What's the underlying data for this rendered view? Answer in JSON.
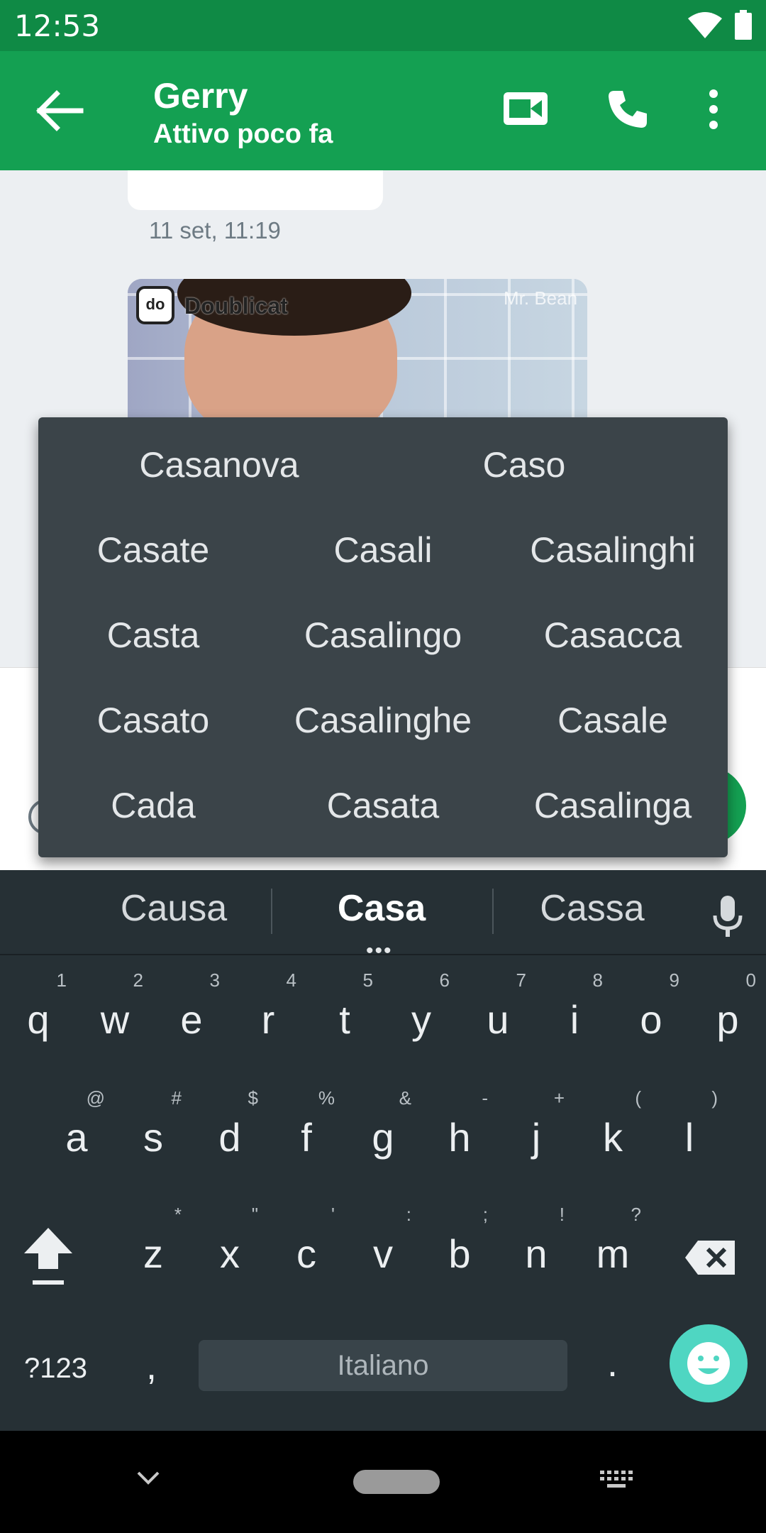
{
  "status_bar": {
    "time": "12:53"
  },
  "header": {
    "contact_name": "Gerry",
    "contact_status": "Attivo poco fa"
  },
  "chat": {
    "message_time": "11 set, 11:19",
    "gif": {
      "brand": "Doublicat",
      "logo_text": "do",
      "watermark": "Mr. Bean"
    }
  },
  "word_suggestions": {
    "rows": [
      [
        "Casanova",
        "Caso"
      ],
      [
        "Casate",
        "Casali",
        "Casalinghi"
      ],
      [
        "Casta",
        "Casalingo",
        "Casacca"
      ],
      [
        "Casato",
        "Casalinghe",
        "Casale"
      ],
      [
        "Cada",
        "Casata",
        "Casalinga"
      ]
    ]
  },
  "keyboard": {
    "suggestions": [
      "Causa",
      "Casa",
      "Cassa"
    ],
    "suggestion_more": "•••",
    "row1": [
      [
        "q",
        "1"
      ],
      [
        "w",
        "2"
      ],
      [
        "e",
        "3"
      ],
      [
        "r",
        "4"
      ],
      [
        "t",
        "5"
      ],
      [
        "y",
        "6"
      ],
      [
        "u",
        "7"
      ],
      [
        "i",
        "8"
      ],
      [
        "o",
        "9"
      ],
      [
        "p",
        "0"
      ]
    ],
    "row2": [
      [
        "a",
        "@"
      ],
      [
        "s",
        "#"
      ],
      [
        "d",
        "$"
      ],
      [
        "f",
        "%"
      ],
      [
        "g",
        "&"
      ],
      [
        "h",
        "-"
      ],
      [
        "j",
        "+"
      ],
      [
        "k",
        "("
      ],
      [
        "l",
        ")"
      ]
    ],
    "row3": [
      [
        "z",
        "*"
      ],
      [
        "x",
        "\""
      ],
      [
        "c",
        "'"
      ],
      [
        "v",
        ":"
      ],
      [
        "b",
        ";"
      ],
      [
        "n",
        "!"
      ],
      [
        "m",
        "?"
      ]
    ],
    "symbols_label": "?123",
    "comma": ",",
    "space_label": "Italiano",
    "period": "."
  },
  "colors": {
    "app_bar": "#14a052",
    "status_bar": "#0f8a45",
    "keyboard_bg": "#263035",
    "popup_bg": "#3b4449",
    "emoji_key": "#4fd6c2"
  }
}
